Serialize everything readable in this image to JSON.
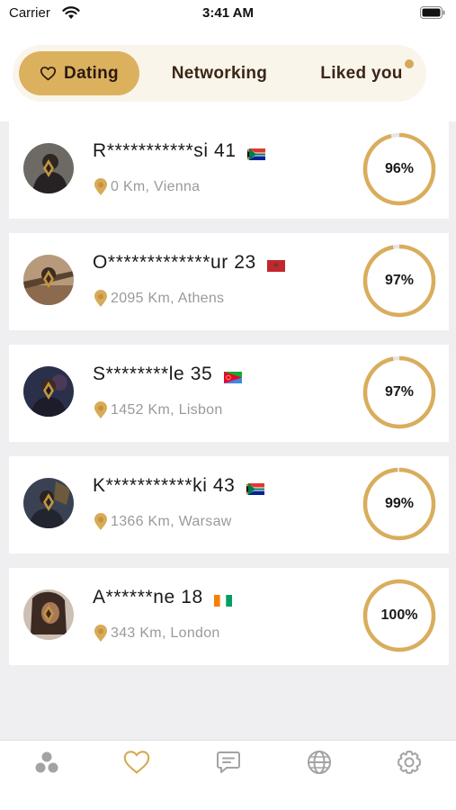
{
  "status_bar": {
    "carrier": "Carrier",
    "time": "3:41 AM"
  },
  "segment": {
    "tabs": [
      {
        "label": "Dating",
        "active": true
      },
      {
        "label": "Networking",
        "active": false
      },
      {
        "label": "Liked you",
        "active": false,
        "has_notification": true
      }
    ]
  },
  "colors": {
    "accent": "#dcb15e",
    "ring": "#d9ad5c",
    "ring_track": "#e6e6e6"
  },
  "matches": [
    {
      "name": "R***********si 41",
      "flag": "south-africa",
      "location": "0 Km, Vienna",
      "percent_label": "96%",
      "percent": 96
    },
    {
      "name": "O*************ur 23",
      "flag": "morocco",
      "location": "2095 Km, Athens",
      "percent_label": "97%",
      "percent": 97
    },
    {
      "name": "S********le 35",
      "flag": "eritrea",
      "location": "1452 Km, Lisbon",
      "percent_label": "97%",
      "percent": 97
    },
    {
      "name": "K***********ki 43",
      "flag": "south-africa",
      "location": "1366 Km, Warsaw",
      "percent_label": "99%",
      "percent": 99
    },
    {
      "name": "A******ne 18",
      "flag": "ivory-coast",
      "location": "343 Km, London",
      "percent_label": "100%",
      "percent": 100
    }
  ],
  "tabbar": {
    "items": [
      {
        "icon": "community-icon",
        "active": false
      },
      {
        "icon": "heart-icon",
        "active": true
      },
      {
        "icon": "chat-icon",
        "active": false
      },
      {
        "icon": "globe-icon",
        "active": false
      },
      {
        "icon": "settings-icon",
        "active": false
      }
    ]
  }
}
